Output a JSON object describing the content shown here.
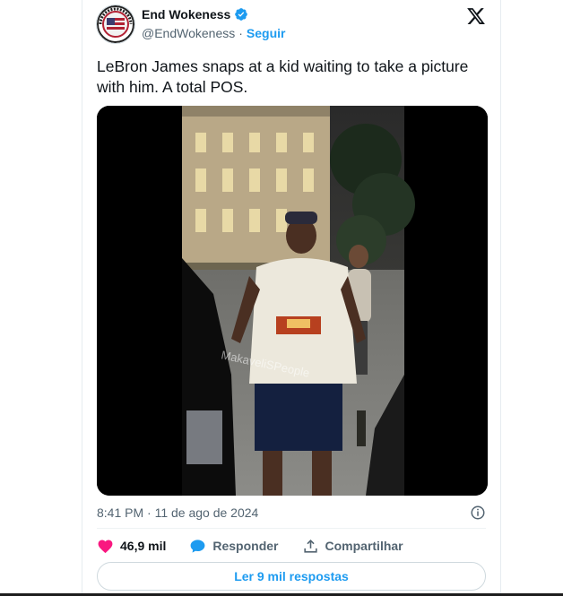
{
  "author": {
    "display_name": "End Wokeness",
    "handle": "@EndWokeness",
    "separator": "·",
    "follow_label": "Seguir"
  },
  "tweet": {
    "text": "LeBron James snaps at a kid waiting to take a picture with him. A total POS.",
    "timestamp": "8:41 PM · 11 de ago de 2024",
    "video_watermark": "MakaveliSPeople"
  },
  "actions": {
    "likes": "46,9 mil",
    "reply_label": "Responder",
    "share_label": "Compartilhar"
  },
  "read_replies_label": "Ler 9 mil respostas",
  "icons": {
    "verified": "verified-badge-icon",
    "x_logo": "x-logo-icon",
    "info": "info-icon",
    "like": "heart-icon",
    "reply": "speech-bubble-icon",
    "share": "share-icon"
  },
  "colors": {
    "accent": "#1d9bf0",
    "like": "#f91880",
    "secondary_text": "#536471",
    "primary_text": "#0f1419"
  }
}
